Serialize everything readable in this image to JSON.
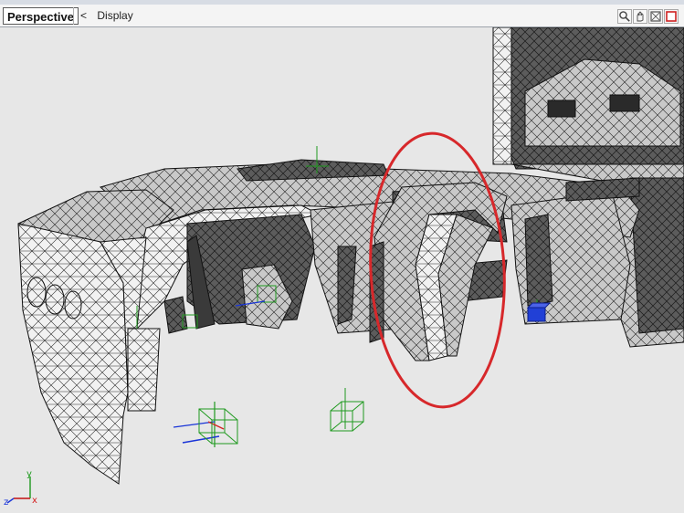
{
  "viewport_header": {
    "tab_label": "Perspective",
    "back_glyph": "<",
    "menu_label": "Display"
  },
  "tools": [
    {
      "name": "zoom-icon"
    },
    {
      "name": "pan-icon"
    },
    {
      "name": "maximize-icon"
    },
    {
      "name": "close-icon"
    }
  ],
  "axis": {
    "y_label": "y",
    "x_label": "x",
    "z_label": "z"
  },
  "colors": {
    "wireframe": "#1b1b1b",
    "mesh_light": "#efefef",
    "mesh_dark": "#5a5a5a",
    "highlight_ellipse": "#d7282b",
    "gizmo_green": "#1f9a1f",
    "gizmo_blue": "#1a35d8",
    "gizmo_red": "#d42323",
    "selected_cube": "#2140d6"
  }
}
